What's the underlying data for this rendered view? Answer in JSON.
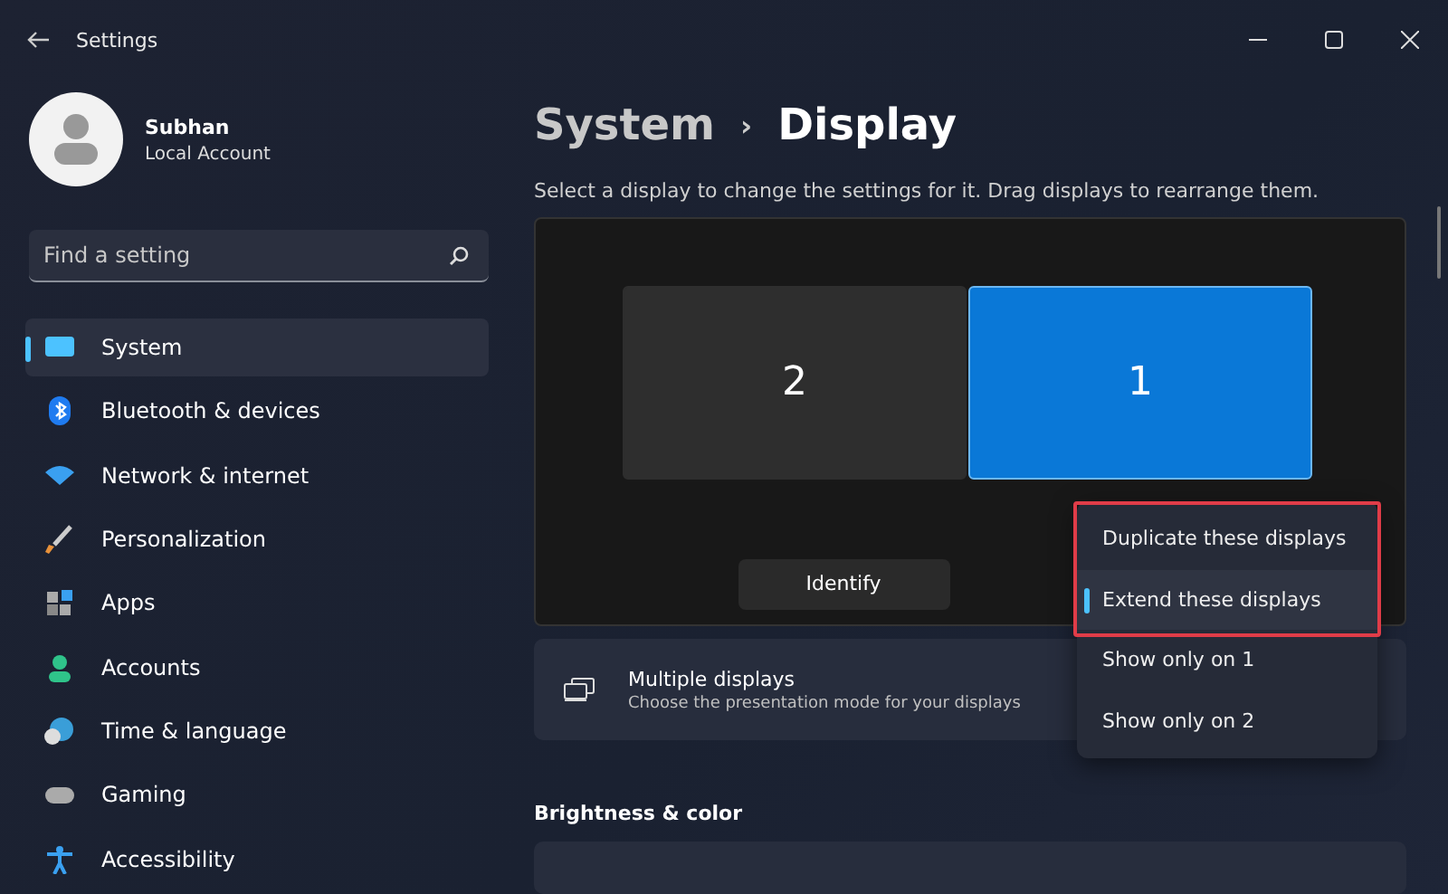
{
  "window": {
    "title": "Settings"
  },
  "profile": {
    "name": "Subhan",
    "account": "Local Account"
  },
  "search": {
    "placeholder": "Find a setting"
  },
  "nav": [
    {
      "label": "System",
      "selected": true
    },
    {
      "label": "Bluetooth & devices",
      "selected": false
    },
    {
      "label": "Network & internet",
      "selected": false
    },
    {
      "label": "Personalization",
      "selected": false
    },
    {
      "label": "Apps",
      "selected": false
    },
    {
      "label": "Accounts",
      "selected": false
    },
    {
      "label": "Time & language",
      "selected": false
    },
    {
      "label": "Gaming",
      "selected": false
    },
    {
      "label": "Accessibility",
      "selected": false
    }
  ],
  "breadcrumb": {
    "parent": "System",
    "separator": "›",
    "current": "Display"
  },
  "hint": "Select a display to change the settings for it. Drag displays to rearrange them.",
  "monitors": [
    {
      "label": "2",
      "selected": false
    },
    {
      "label": "1",
      "selected": true
    }
  ],
  "identify_button": "Identify",
  "menu": [
    {
      "label": "Duplicate these displays",
      "selected": false,
      "highlighted": true
    },
    {
      "label": "Extend these displays",
      "selected": true,
      "highlighted": true
    },
    {
      "label": "Show only on 1",
      "selected": false,
      "highlighted": false
    },
    {
      "label": "Show only on 2",
      "selected": false,
      "highlighted": false
    }
  ],
  "multiple_displays": {
    "title": "Multiple displays",
    "description": "Choose the presentation mode for your displays"
  },
  "section": "Brightness & color"
}
